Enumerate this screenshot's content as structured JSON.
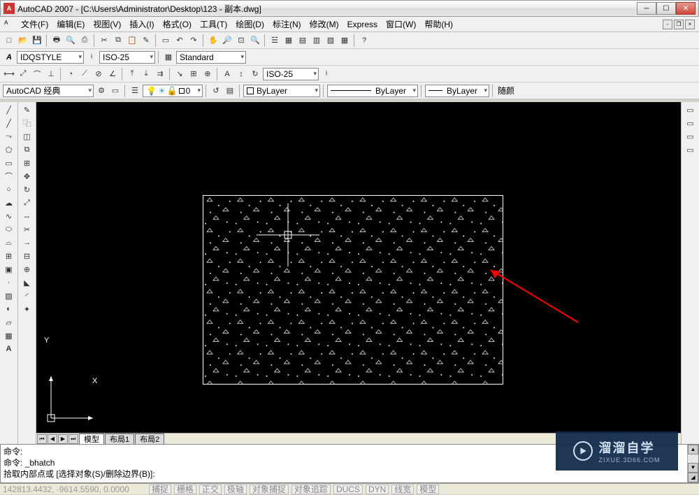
{
  "title": "AutoCAD 2007 - [C:\\Users\\Administrator\\Desktop\\123 - 副本.dwg]",
  "menu": [
    "文件(F)",
    "编辑(E)",
    "视图(V)",
    "插入(I)",
    "格式(O)",
    "工具(T)",
    "绘图(D)",
    "标注(N)",
    "修改(M)",
    "Express",
    "窗口(W)",
    "帮助(H)"
  ],
  "row2": {
    "style_combo": "IDQSTYLE",
    "dim_combo": "ISO-25",
    "text_style": "Standard"
  },
  "row3": {
    "dim_combo2": "ISO-25"
  },
  "row4": {
    "workspace": "AutoCAD 经典",
    "layer_combo": "0",
    "line_combo1": "ByLayer",
    "line_combo2": "ByLayer",
    "line_combo3": "ByLayer",
    "trunc": "随颜"
  },
  "tabs": {
    "model": "模型",
    "layout1": "布局1",
    "layout2": "布局2"
  },
  "cmd": {
    "l1": "命令:",
    "l2": "命令: _bhatch",
    "l3": "拾取内部点或 [选择对象(S)/删除边界(B)]:"
  },
  "status": {
    "coords": "142813.4432, -9614.5590, 0.0000",
    "btns": [
      "捕捉",
      "栅格",
      "正交",
      "极轴",
      "对象捕捉",
      "对象追踪",
      "DUCS",
      "DYN",
      "线宽",
      "模型"
    ]
  },
  "watermark": {
    "big": "溜溜自学",
    "small": "ZIXUE.3D66.COM"
  },
  "ucs": {
    "x": "X",
    "y": "Y"
  }
}
